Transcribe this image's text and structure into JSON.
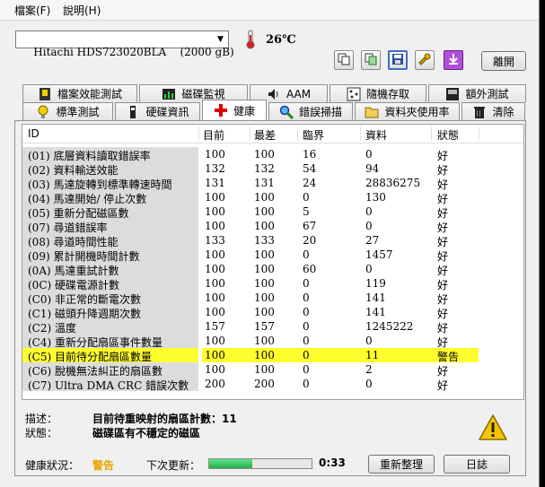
{
  "menu": {
    "file": "檔案(F)",
    "help": "說明(H)"
  },
  "toolbar": {
    "drive": "Hitachi HDS723020BLA    (2000 gB)",
    "temperature": "26℃",
    "exit_label": "離開",
    "icons": [
      "copy-icon",
      "copy-green-icon",
      "save-icon",
      "tools-icon",
      "download-icon"
    ]
  },
  "tabs_row1": [
    {
      "label": "檔案效能測試",
      "icon": "file-benchmark-icon"
    },
    {
      "label": "磁碟監視",
      "icon": "monitor-icon"
    },
    {
      "label": "AAM",
      "icon": "speaker-icon"
    },
    {
      "label": "隨機存取",
      "icon": "random-access-icon"
    },
    {
      "label": "額外測試",
      "icon": "extra-tests-icon"
    }
  ],
  "tabs_row2": [
    {
      "label": "標準測試",
      "icon": "bulb-icon"
    },
    {
      "label": "硬碟資訊",
      "icon": "info-icon"
    },
    {
      "label": "健康",
      "icon": "health-cross-icon",
      "active": true
    },
    {
      "label": "錯誤掃描",
      "icon": "magnifier-icon"
    },
    {
      "label": "資料夾使用率",
      "icon": "folder-icon"
    },
    {
      "label": "清除",
      "icon": "trash-icon"
    }
  ],
  "columns": [
    "ID",
    "目前",
    "最差",
    "臨界",
    "資料",
    "狀態"
  ],
  "rows": [
    [
      "(01) 底層資料讀取錯誤率",
      "100",
      "100",
      "16",
      "0",
      "好"
    ],
    [
      "(02) 資料輸送效能",
      "132",
      "132",
      "54",
      "94",
      "好"
    ],
    [
      "(03) 馬達旋轉到標準轉速時間",
      "131",
      "131",
      "24",
      "28836275",
      "好"
    ],
    [
      "(04) 馬達開始/ 停止次數",
      "100",
      "100",
      "0",
      "130",
      "好"
    ],
    [
      "(05) 重新分配磁區數",
      "100",
      "100",
      "5",
      "0",
      "好"
    ],
    [
      "(07) 尋道錯誤率",
      "100",
      "100",
      "67",
      "0",
      "好"
    ],
    [
      "(08) 尋道時間性能",
      "133",
      "133",
      "20",
      "27",
      "好"
    ],
    [
      "(09) 累計開機時間計數",
      "100",
      "100",
      "0",
      "1457",
      "好"
    ],
    [
      "(0A) 馬達重試計數",
      "100",
      "100",
      "60",
      "0",
      "好"
    ],
    [
      "(0C) 硬碟電源計數",
      "100",
      "100",
      "0",
      "119",
      "好"
    ],
    [
      "(C0) 非正常的斷電次數",
      "100",
      "100",
      "0",
      "141",
      "好"
    ],
    [
      "(C1) 磁頭升降週期次數",
      "100",
      "100",
      "0",
      "141",
      "好"
    ],
    [
      "(C2) 溫度",
      "157",
      "157",
      "0",
      "1245222",
      "好"
    ],
    [
      "(C4) 重新分配扇區事件數量",
      "100",
      "100",
      "0",
      "0",
      "好"
    ],
    [
      "(C5) 目前待分配扇區數量",
      "100",
      "100",
      "0",
      "11",
      "警告"
    ],
    [
      "(C6) 脫機無法糾正的扇區數",
      "100",
      "100",
      "0",
      "2",
      "好"
    ],
    [
      "(C7) Ultra DMA CRC 錯誤次數",
      "200",
      "200",
      "0",
      "0",
      "好"
    ]
  ],
  "warning_row_index": 14,
  "description": {
    "desc_label": "描述：",
    "desc_value": "目前待重映射的扇區計數：11",
    "status_label": "狀態：",
    "status_value": "磁碟區有不穩定的磁區"
  },
  "status_bar": {
    "health_label": "健康狀況：",
    "health_value": "警告",
    "next_update_label": "下次更新：",
    "progress_fraction": 0.42,
    "countdown": "0:33",
    "refresh_label": "重新整理",
    "log_label": "日誌"
  },
  "colors": {
    "warning_highlight": "#ffff30",
    "health_warning": "#e8a800",
    "progress": "#22b14c"
  }
}
